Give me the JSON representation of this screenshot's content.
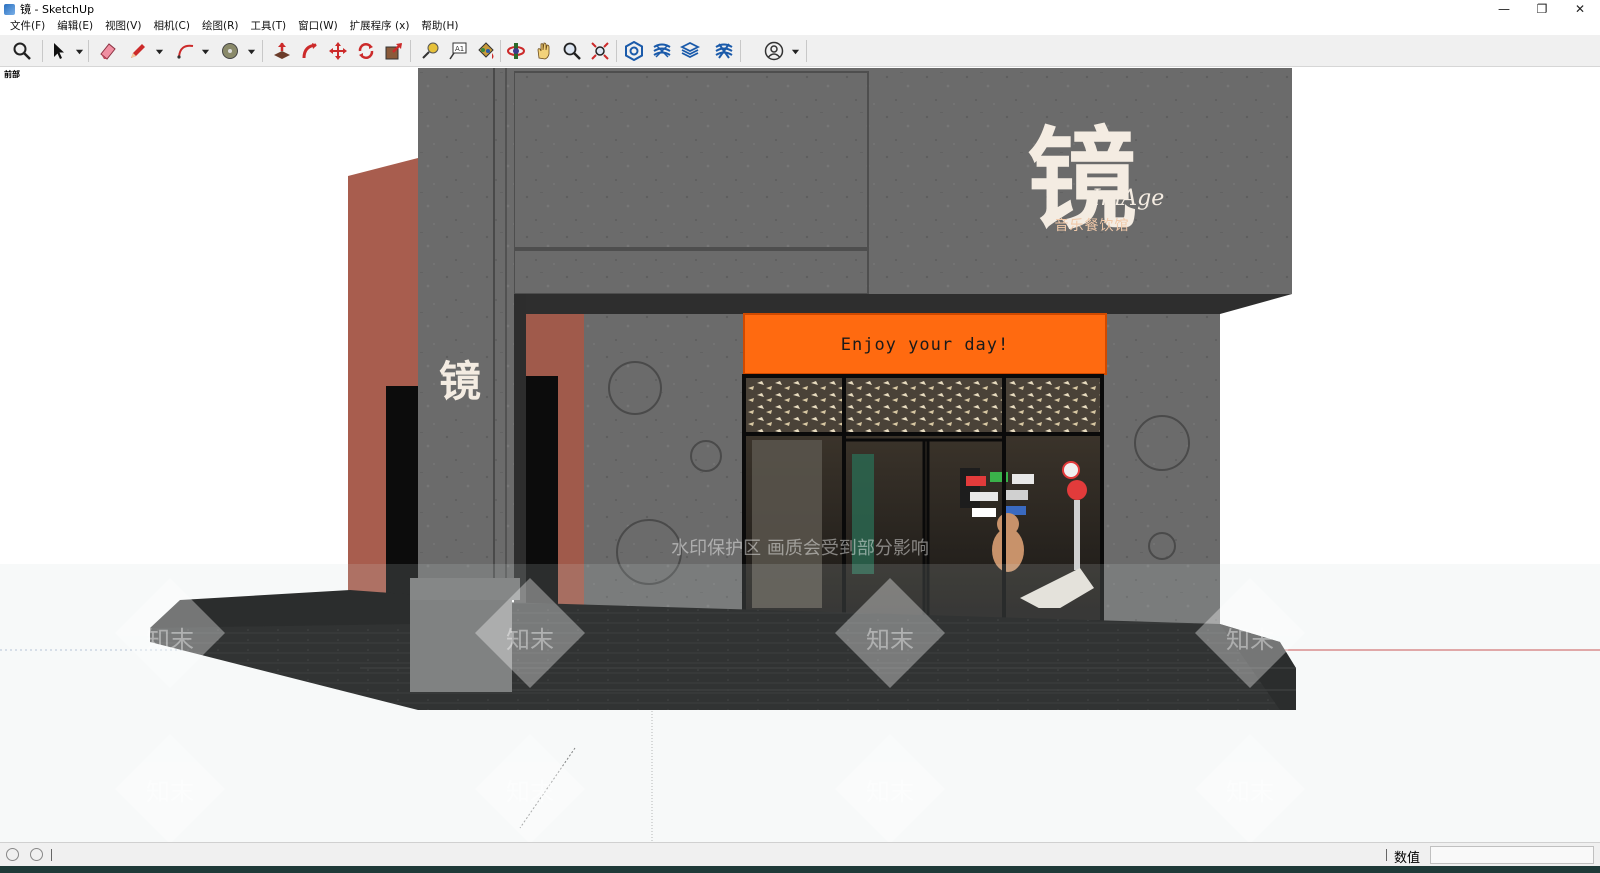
{
  "window": {
    "title": "镜 - SketchUp"
  },
  "menu": {
    "items": [
      "文件(F)",
      "编辑(E)",
      "视图(V)",
      "相机(C)",
      "绘图(R)",
      "工具(T)",
      "窗口(W)",
      "扩展程序 (x)",
      "帮助(H)"
    ]
  },
  "toolbar": {
    "tools": [
      "search-icon",
      "select-icon",
      "eraser-icon",
      "pencil-icon",
      "arc-icon",
      "shape-icon",
      "pushpull-icon",
      "followme-icon",
      "move-icon",
      "rotate-icon",
      "scale-icon",
      "tape-measure-icon",
      "text-icon",
      "paint-bucket-icon",
      "orbit-icon",
      "pan-icon",
      "zoom-icon",
      "zoom-extents-icon",
      "warehouse-icon",
      "extension-warehouse-icon",
      "layout-icon",
      "extension-manager-icon",
      "account-icon"
    ]
  },
  "viewport": {
    "scene_label": "前部",
    "sign_text": "Enjoy your day!",
    "logo_main": "镜",
    "logo_sub": "ImAge",
    "logo_tagline": "音乐餐饮馆",
    "watermark_main": "水印保护区  画质会受到部分影响",
    "watermark_brand": "知末"
  },
  "status": {
    "measurement_label": "数值",
    "measurement_value": ""
  },
  "colors": {
    "wall_gray": "#6a6a6a",
    "wall_brick": "#a85d4e",
    "sign_orange": "#ff6a10",
    "floor_black": "#111111",
    "toolbar_bg": "#f0f0f0"
  }
}
